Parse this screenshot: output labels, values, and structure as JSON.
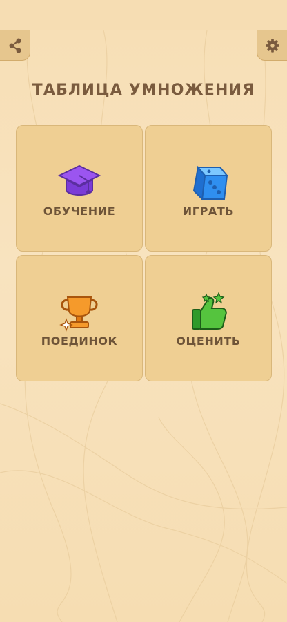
{
  "app": {
    "title": "ТАБЛИЦА УМНОЖЕНИЯ"
  },
  "toolbar": {
    "share_icon": "share-icon",
    "settings_icon": "gear-icon"
  },
  "menu": [
    {
      "label": "ОБУЧЕНИЕ",
      "icon": "graduation-cap-icon",
      "color": "#8a49e0"
    },
    {
      "label": "ИГРАТЬ",
      "icon": "dice-icon",
      "color": "#2f8ff0"
    },
    {
      "label": "ПОЕДИНОК",
      "icon": "trophy-icon",
      "color": "#f08a1e"
    },
    {
      "label": "ОЦЕНИТЬ",
      "icon": "thumbs-up-icon",
      "color": "#4fbf3a"
    }
  ],
  "colors": {
    "background": "#f7e1bb",
    "tile": "#efcf93",
    "text": "#6e5438"
  }
}
